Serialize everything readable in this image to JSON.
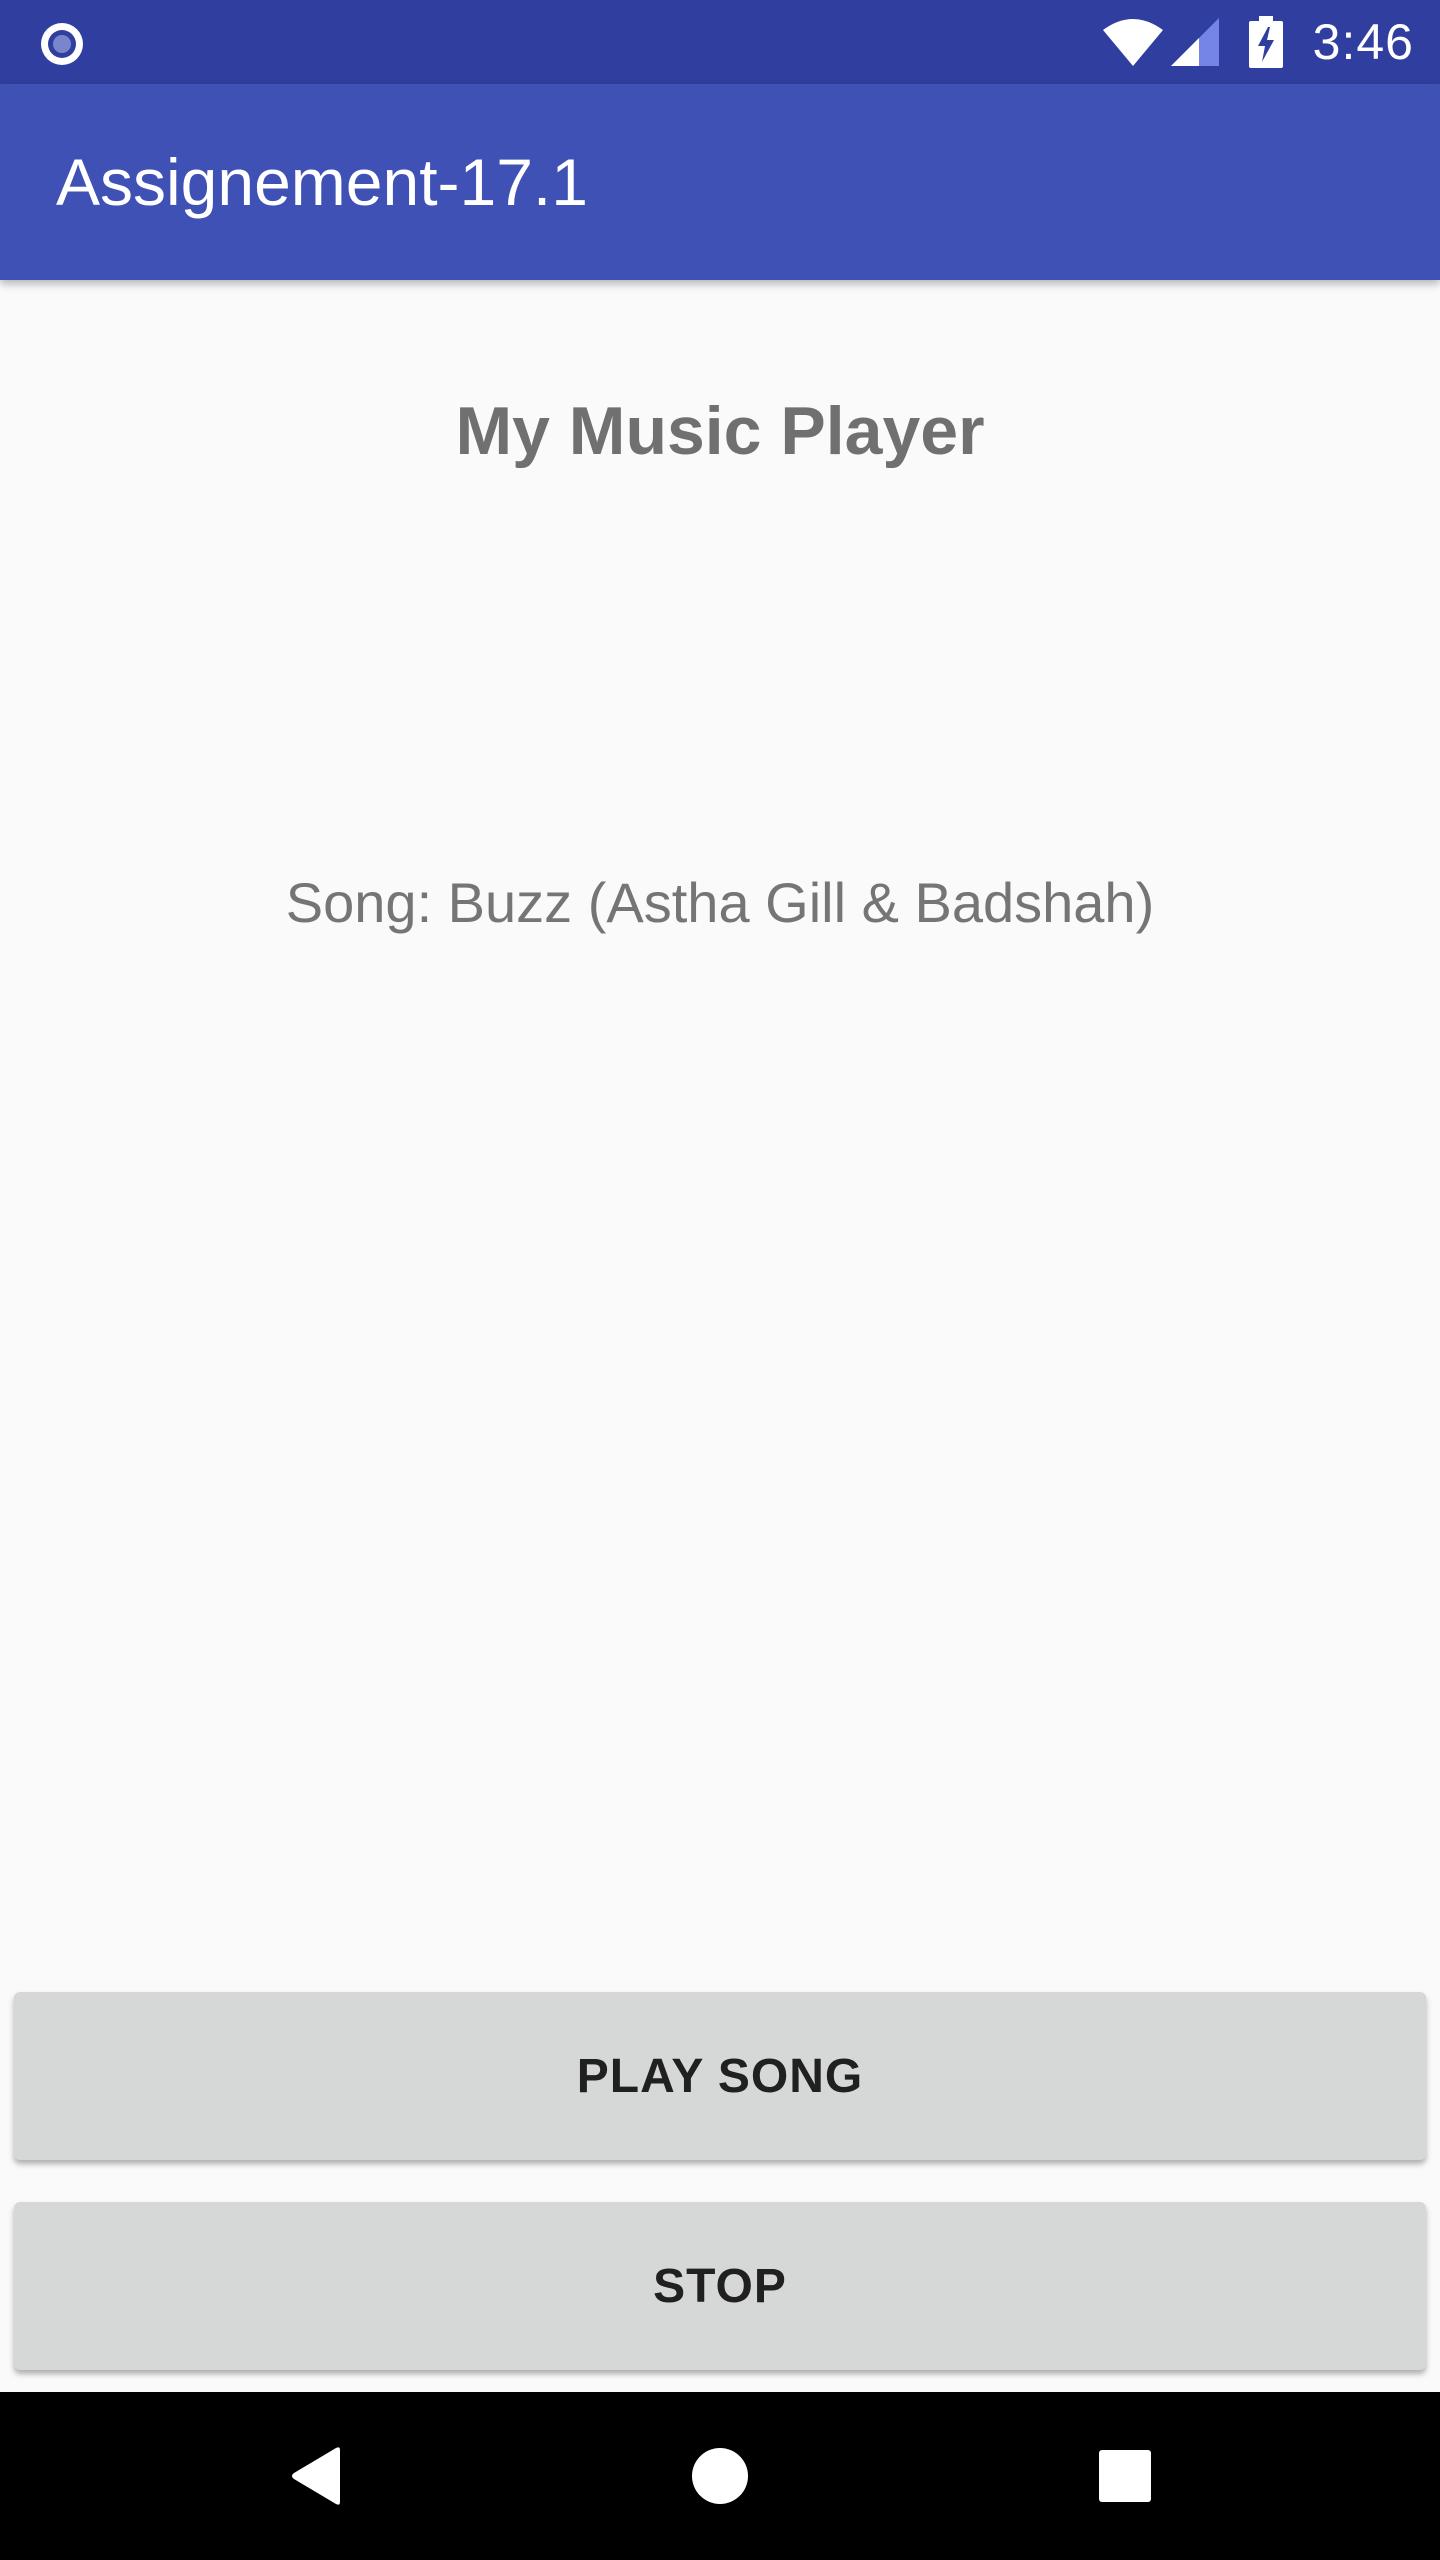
{
  "status_bar": {
    "notification_icon": "radio-circle-icon",
    "wifi_icon": "wifi-icon",
    "signal_icon": "signal-icon",
    "battery_icon": "battery-charging-icon",
    "time": "3:46",
    "background_color": "#303f9f"
  },
  "toolbar": {
    "title": "Assignement-17.1",
    "background_color": "#3f51b5"
  },
  "main": {
    "heading": "My Music Player",
    "song_label": "Song: Buzz (Astha Gill & Badshah)"
  },
  "buttons": {
    "play_label": "PLAY SONG",
    "stop_label": "STOP"
  },
  "nav_bar": {
    "back_icon": "back-triangle-icon",
    "home_icon": "home-circle-icon",
    "recents_icon": "recents-square-icon"
  }
}
